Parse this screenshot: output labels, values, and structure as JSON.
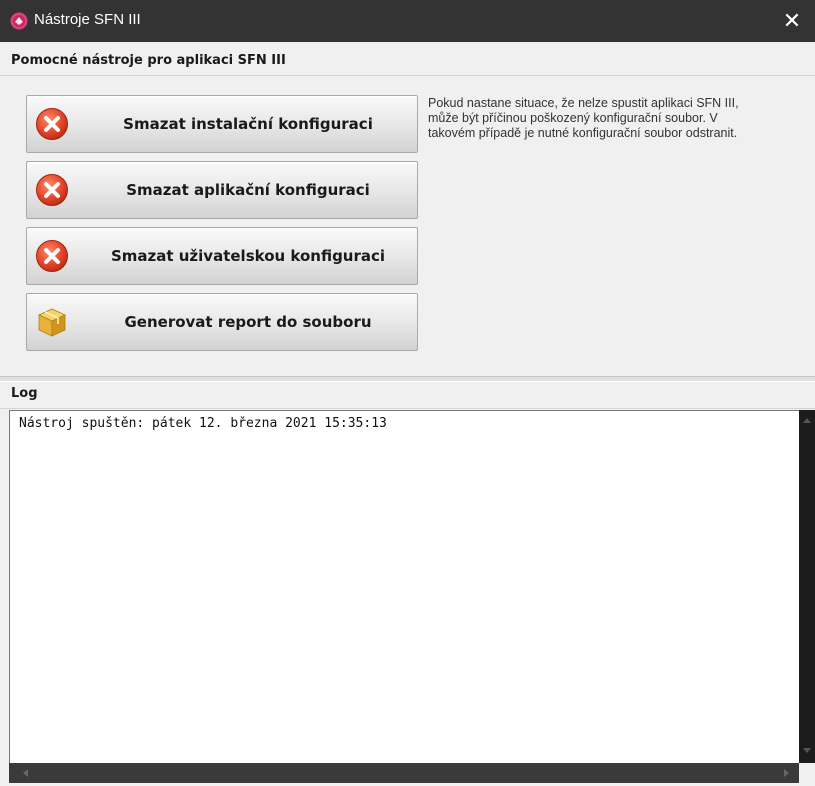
{
  "window": {
    "title": "Nástroje SFN III",
    "close_glyph": "✕",
    "title_icon": "app-logo-icon",
    "titlebar_color": "#333333"
  },
  "tools": {
    "header": "Pomocné nástroje pro aplikaci SFN III",
    "buttons": [
      {
        "label": "Smazat instalační konfiguraci",
        "icon": "delete-icon"
      },
      {
        "label": "Smazat aplikační konfiguraci",
        "icon": "delete-icon"
      },
      {
        "label": "Smazat uživatelskou konfiguraci",
        "icon": "delete-icon"
      },
      {
        "label": "Generovat report do souboru",
        "icon": "package-icon"
      }
    ],
    "info_lines": [
      "Pokud nastane situace, že nelze spustit aplikaci SFN III,",
      "může být příčinou poškozený konfigurační soubor. V",
      "takovém případě je nutné konfigurační soubor odstranit."
    ]
  },
  "log": {
    "header": "Log",
    "lines": [
      "Nástroj spuštěn: pátek 12. března 2021 15:35:13"
    ]
  },
  "colors": {
    "delete_icon_red": "#e5462c",
    "package_icon_yellow": "#e8b23a"
  }
}
